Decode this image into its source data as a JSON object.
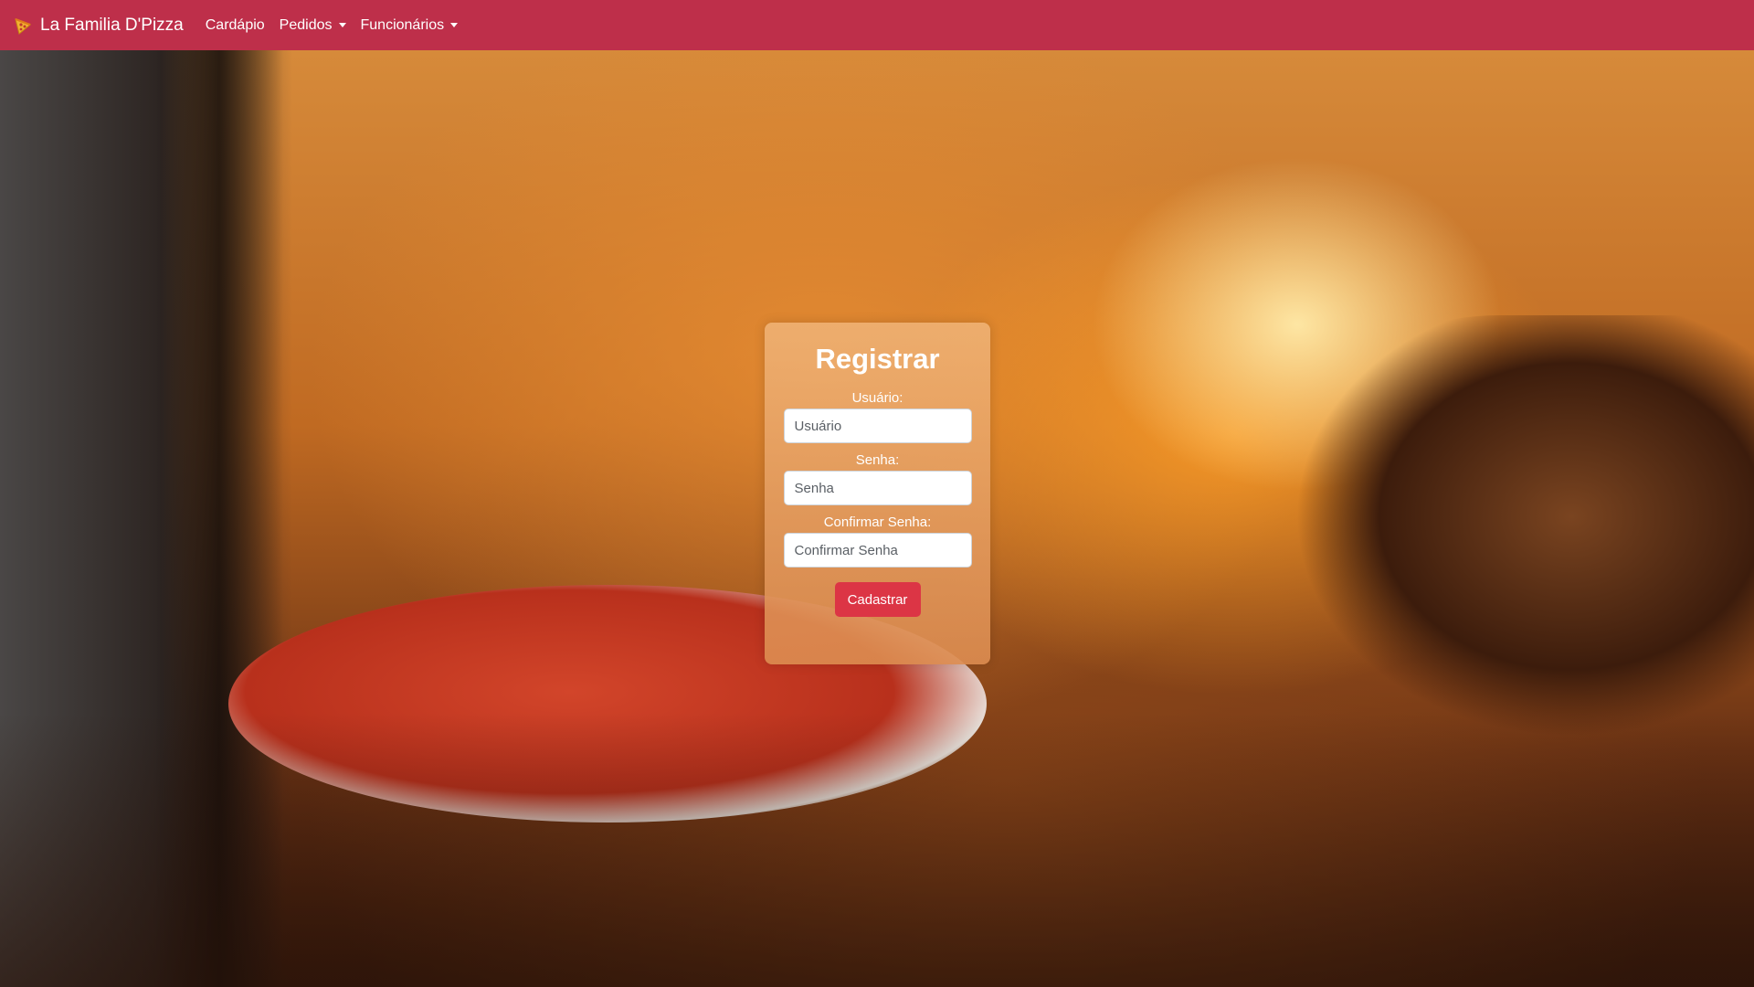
{
  "navbar": {
    "brand": "La Familia D'Pizza",
    "brand_icon": "pizza-icon",
    "items": [
      {
        "label": "Cardápio",
        "dropdown": false
      },
      {
        "label": "Pedidos",
        "dropdown": true
      },
      {
        "label": "Funcionários",
        "dropdown": true
      }
    ],
    "background_color": "#be2f4a"
  },
  "form": {
    "title": "Registrar",
    "fields": [
      {
        "label": "Usuário:",
        "placeholder": "Usuário",
        "value": ""
      },
      {
        "label": "Senha:",
        "placeholder": "Senha",
        "value": ""
      },
      {
        "label": "Confirmar Senha:",
        "placeholder": "Confirmar Senha",
        "value": ""
      }
    ],
    "submit_label": "Cadastrar",
    "submit_color": "#dc3545"
  }
}
